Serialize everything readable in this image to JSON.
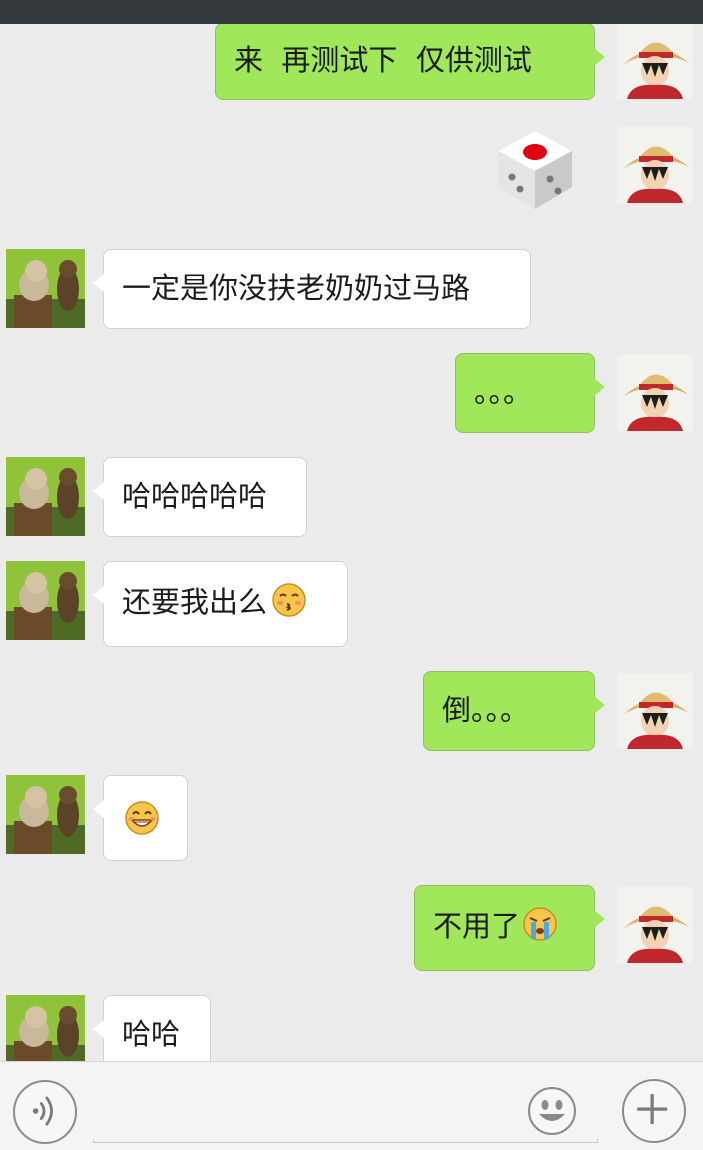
{
  "messages": [
    {
      "side": "me",
      "text": "来  再测试下  仅供测试"
    },
    {
      "side": "me",
      "type": "dice"
    },
    {
      "side": "other",
      "text": "一定是你没扶老奶奶过马路"
    },
    {
      "side": "me",
      "text": "。。。"
    },
    {
      "side": "other",
      "text": "哈哈哈哈哈"
    },
    {
      "side": "other",
      "text": "还要我出么",
      "emoji": "kissing-face"
    },
    {
      "side": "me",
      "text": "倒。。。"
    },
    {
      "side": "other",
      "text": "",
      "emoji": "grinning-face"
    },
    {
      "side": "me",
      "text": "不用了",
      "emoji": "crying-face"
    },
    {
      "side": "other",
      "text": "哈哈"
    }
  ],
  "input": {
    "placeholder": "",
    "value": "",
    "icons": [
      "voice-icon",
      "emoji-icon",
      "plus-icon"
    ]
  },
  "colors": {
    "background": "#ebebeb",
    "my_bubble": "#a0e75a",
    "their_bubble": "#ffffff",
    "top_bar": "#33393d"
  }
}
